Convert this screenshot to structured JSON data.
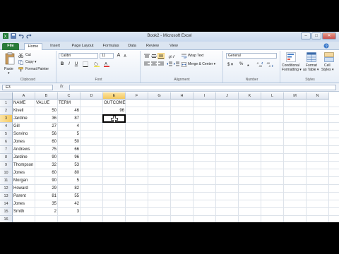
{
  "window": {
    "title": "Book2 - Microsoft Excel",
    "buttons": {
      "minimize": "–",
      "maximize": "□",
      "close": "✕"
    }
  },
  "ribbon_tabs": [
    "File",
    "Home",
    "Insert",
    "Page Layout",
    "Formulas",
    "Data",
    "Review",
    "View"
  ],
  "clipboard": {
    "paste": "Paste",
    "cut": "Cut",
    "copy": "Copy ▾",
    "format_painter": "Format Painter",
    "group": "Clipboard"
  },
  "font": {
    "name": "Calibri",
    "size": "11",
    "group": "Font",
    "grow": "A",
    "shrink": "A",
    "bold": "B",
    "italic": "I",
    "underline": "U"
  },
  "alignment": {
    "wrap_text": "Wrap Text",
    "merge_center": "Merge & Center ▾",
    "group": "Alignment"
  },
  "number": {
    "format": "General",
    "currency": "$ ▾",
    "percent": "%",
    "comma": "❟",
    "group": "Number"
  },
  "styles": {
    "conditional": [
      "Conditional",
      "Formatting ▾"
    ],
    "format_table": [
      "Format",
      "as Table ▾"
    ],
    "cell_styles": [
      "Cell",
      "Styles ▾"
    ],
    "group": "Styles"
  },
  "formula_bar": {
    "name_box": "E3",
    "fx": "fx",
    "value": ""
  },
  "sheet": {
    "columns": [
      "A",
      "B",
      "C",
      "D",
      "E",
      "F",
      "G",
      "H",
      "I",
      "J",
      "K",
      "L",
      "M",
      "N"
    ],
    "selected_column": "E",
    "selected_row": 3,
    "rows": [
      {
        "n": "1",
        "a": "NAME",
        "b": "VALUE",
        "c": "TERM",
        "e": "OUTCOME"
      },
      {
        "n": "2",
        "a": "Kivell",
        "b": "50",
        "c": "46",
        "e": "96"
      },
      {
        "n": "3",
        "a": "Jardine",
        "b": "36",
        "c": "87",
        "e": ""
      },
      {
        "n": "4",
        "a": "Gill",
        "b": "27",
        "c": "4",
        "e": ""
      },
      {
        "n": "5",
        "a": "Sorvino",
        "b": "56",
        "c": "5",
        "e": ""
      },
      {
        "n": "6",
        "a": "Jones",
        "b": "60",
        "c": "50",
        "e": ""
      },
      {
        "n": "7",
        "a": "Andrews",
        "b": "75",
        "c": "66",
        "e": ""
      },
      {
        "n": "8",
        "a": "Jardine",
        "b": "90",
        "c": "96",
        "e": ""
      },
      {
        "n": "9",
        "a": "Thompson",
        "b": "32",
        "c": "53",
        "e": ""
      },
      {
        "n": "10",
        "a": "Jones",
        "b": "60",
        "c": "80",
        "e": ""
      },
      {
        "n": "11",
        "a": "Morgan",
        "b": "90",
        "c": "5",
        "e": ""
      },
      {
        "n": "12",
        "a": "Howard",
        "b": "29",
        "c": "82",
        "e": ""
      },
      {
        "n": "13",
        "a": "Parent",
        "b": "81",
        "c": "55",
        "e": ""
      },
      {
        "n": "14",
        "a": "Jones",
        "b": "35",
        "c": "42",
        "e": ""
      },
      {
        "n": "15",
        "a": "Smith",
        "b": "2",
        "c": "3",
        "e": ""
      },
      {
        "n": "16",
        "a": "",
        "b": "",
        "c": "",
        "e": ""
      }
    ]
  },
  "colors": {
    "file_tab": "#2a7b3a",
    "selected_header": "#f5c95d"
  }
}
